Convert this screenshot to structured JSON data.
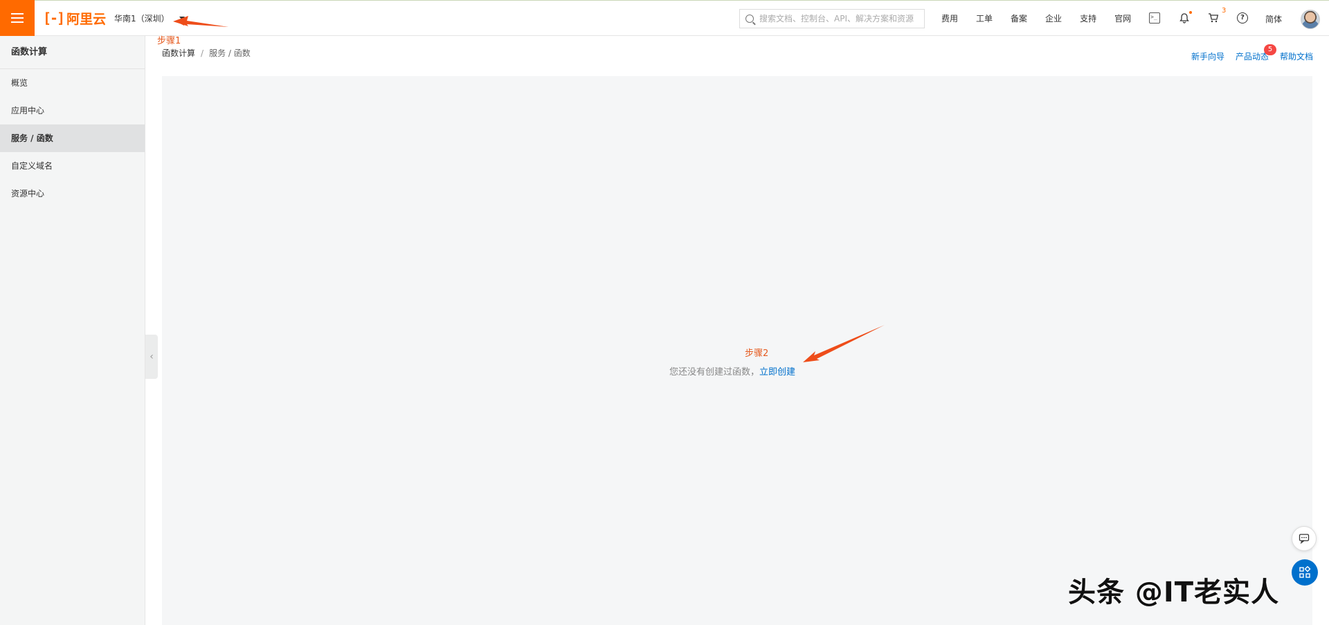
{
  "header": {
    "logo_text": "阿里云",
    "region": "华南1（深圳）",
    "search_placeholder": "搜索文档、控制台、API、解决方案和资源",
    "nav": [
      "费用",
      "工单",
      "备案",
      "企业",
      "支持",
      "官网"
    ],
    "cart_count": "3",
    "lang": "简体"
  },
  "sidebar": {
    "title": "函数计算",
    "items": [
      {
        "label": "概览"
      },
      {
        "label": "应用中心"
      },
      {
        "label": "服务 / 函数"
      },
      {
        "label": "自定义域名"
      },
      {
        "label": "资源中心"
      }
    ],
    "active_index": 2
  },
  "breadcrumb": {
    "root": "函数计算",
    "sep": "/",
    "current": "服务 / 函数"
  },
  "toplinks": {
    "guide": "新手向导",
    "news": "产品动态",
    "news_badge": "5",
    "help": "帮助文档"
  },
  "empty": {
    "message": "您还没有创建过函数，",
    "action": "立即创建"
  },
  "annotations": {
    "step1": "步骤1",
    "step2": "步骤2",
    "watermark": "头条 @IT老实人",
    "color": "#e55a1f"
  },
  "colors": {
    "brand": "#ff6a00",
    "link": "#0070cc",
    "badge": "#f54743"
  }
}
